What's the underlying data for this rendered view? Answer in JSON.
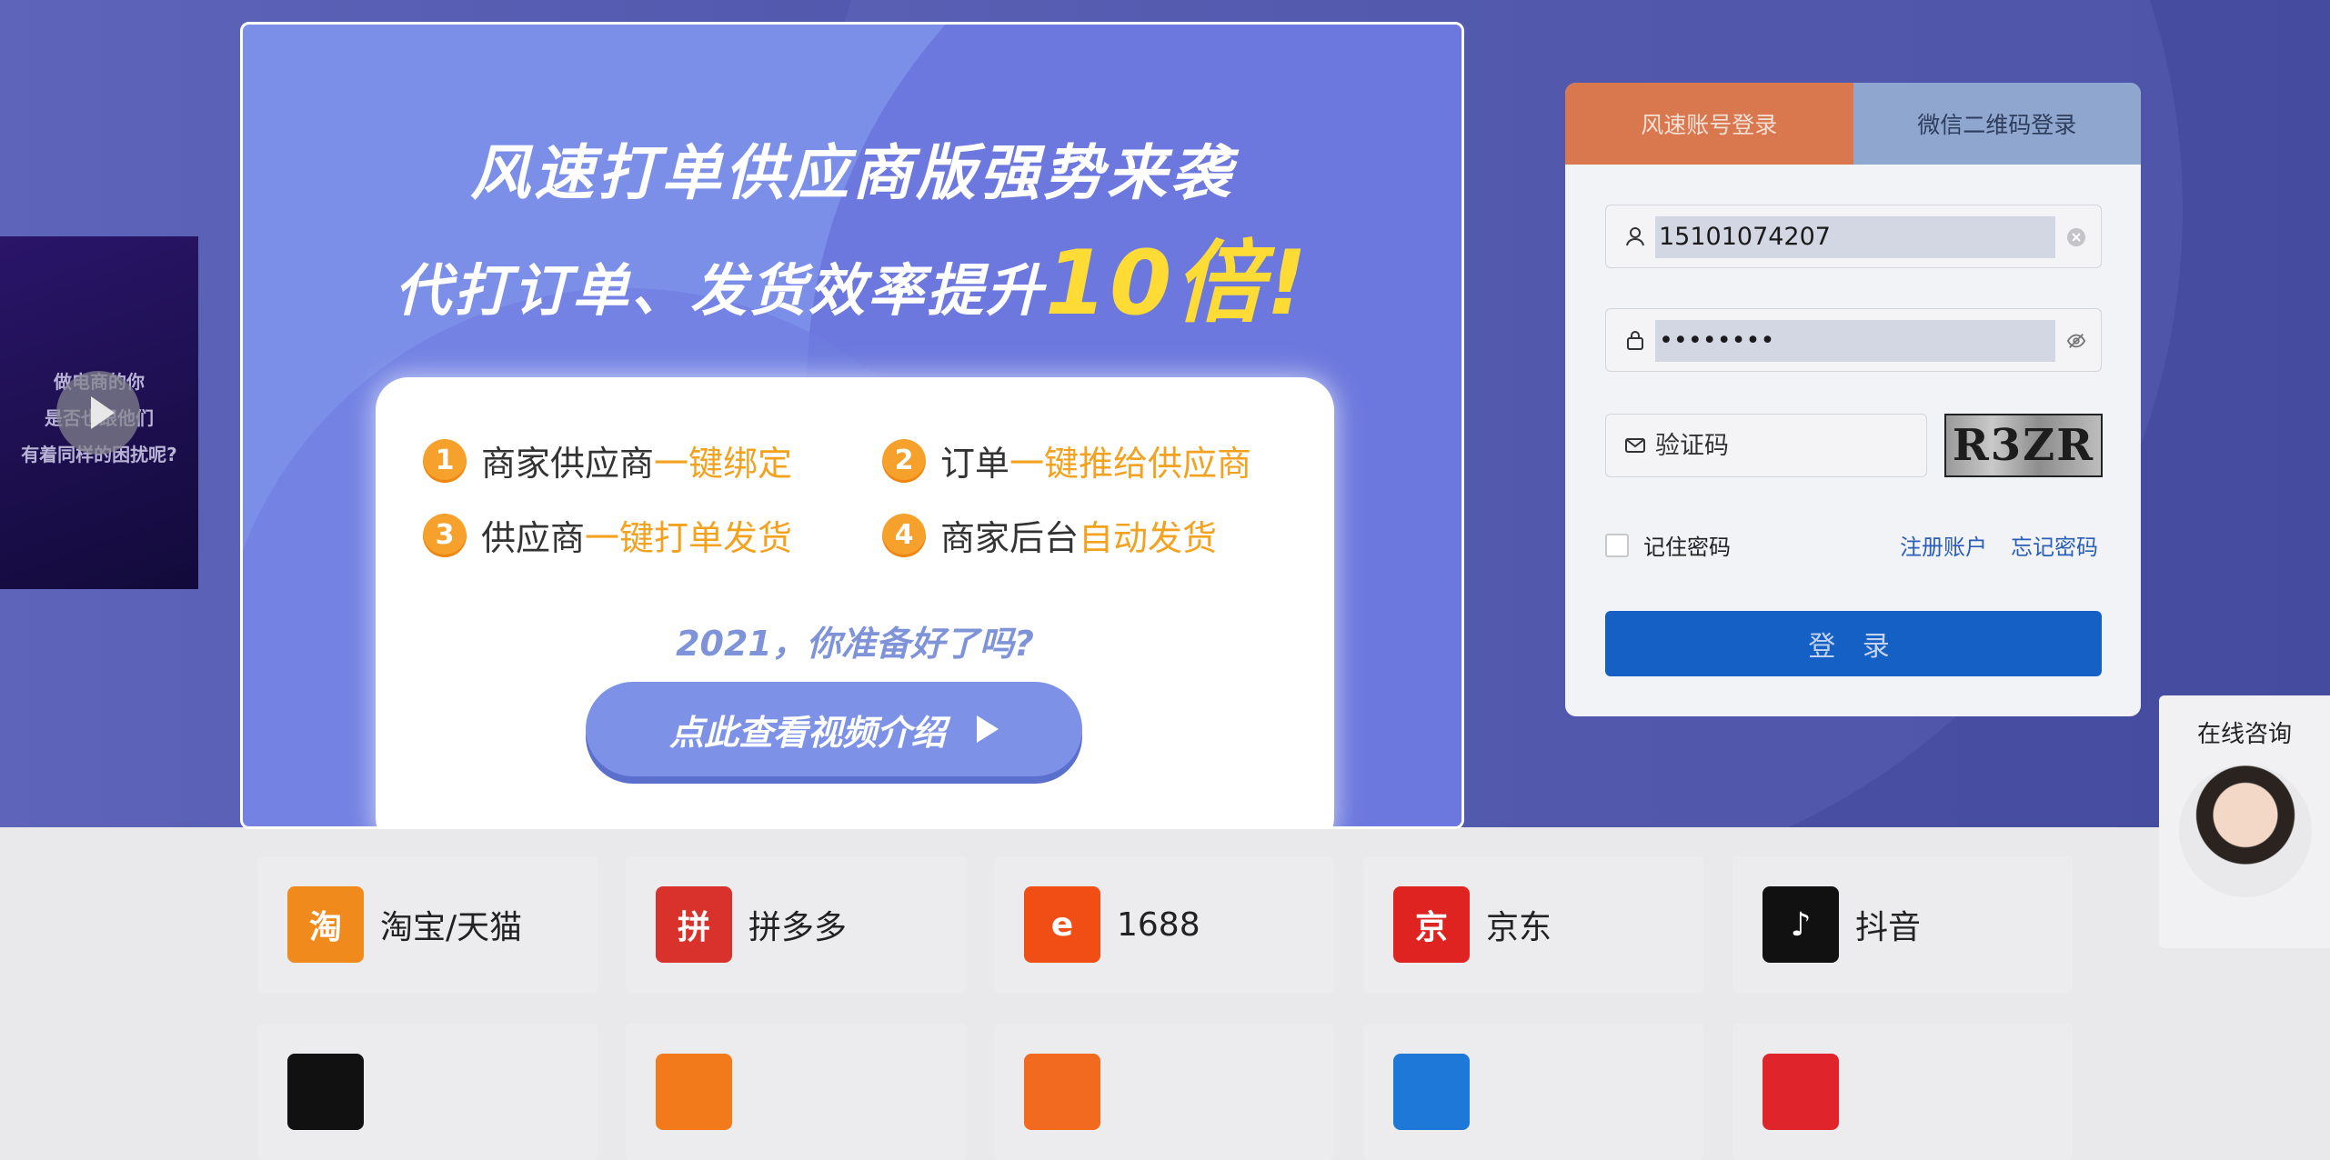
{
  "video_card": {
    "text": "做电商的你\n是否也跟他们\n有着同样的困扰呢?"
  },
  "login": {
    "tabs": [
      {
        "label": "风速账号登录"
      },
      {
        "label": "微信二维码登录"
      }
    ],
    "username": "15101074207",
    "password": "••••••••",
    "code_placeholder": "验证码",
    "captcha": "R3ZR",
    "remember_label": "记住密码",
    "register_link": "注册账户",
    "forgot_link": "忘记密码",
    "submit_label": "登 录"
  },
  "modal": {
    "title_line1": "风速打单供应商版强势来袭",
    "title_line2_prefix": "代打订单、发货效率提升",
    "title_line2_highlight": "10倍!",
    "features": [
      {
        "num": "1",
        "text": "商家供应商",
        "highlight": "一键绑定"
      },
      {
        "num": "2",
        "text": "订单",
        "highlight": "一键推给供应商"
      },
      {
        "num": "3",
        "text": "供应商",
        "highlight": "一键打单发货"
      },
      {
        "num": "4",
        "text": "商家后台",
        "highlight": "自动发货"
      }
    ],
    "question": "2021，你准备好了吗?",
    "video_button": "点此查看视频介绍"
  },
  "platforms": [
    {
      "name": "淘宝/天猫",
      "glyph": "淘",
      "color": "#f08a1c"
    },
    {
      "name": "拼多多",
      "glyph": "拼",
      "color": "#d9322c"
    },
    {
      "name": "1688",
      "glyph": "e",
      "color": "#f04e14"
    },
    {
      "name": "京东",
      "glyph": "京",
      "color": "#df2320"
    },
    {
      "name": "抖音",
      "glyph": "♪",
      "color": "#111111"
    }
  ],
  "chat": {
    "label": "在线咨询"
  }
}
